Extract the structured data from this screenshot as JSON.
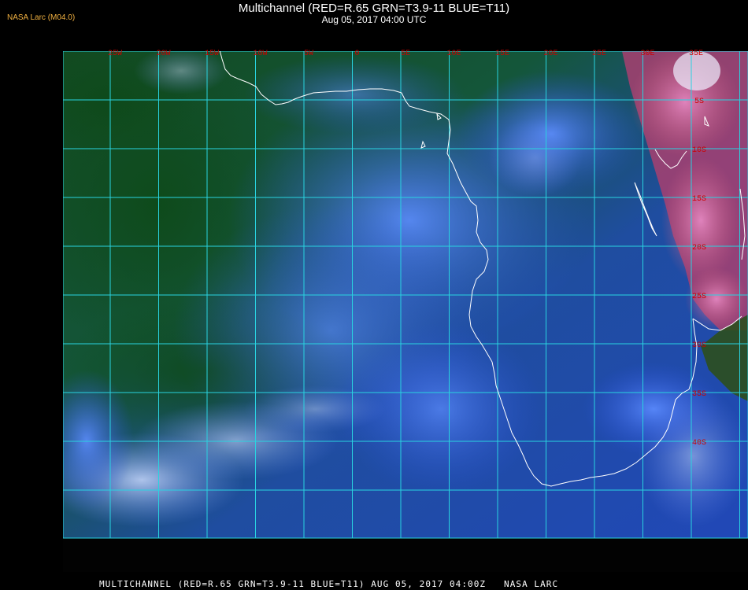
{
  "header": {
    "title": "Multichannel (RED=R.65 GRN=T3.9-11 BLUE=T11)",
    "date": "Aug 05, 2017 04:00 UTC"
  },
  "agency": "NASA Larc (M04.0)",
  "footer": "MULTICHANNEL (RED=R.65 GRN=T3.9-11 BLUE=T11) AUG 05, 2017 04:00Z   NASA LARC",
  "map": {
    "grid_color": "#29d3e0",
    "coast_color": "#ffffff",
    "label_color": "#cc0000",
    "longitude_labels": [
      "25W",
      "20W",
      "15W",
      "10W",
      "5W",
      "0",
      "5E",
      "10E",
      "15E",
      "20E",
      "25E",
      "30E",
      "35E"
    ],
    "latitude_labels": [
      "5S",
      "10S",
      "15S",
      "20S",
      "25S",
      "30S",
      "35S",
      "40S"
    ]
  }
}
